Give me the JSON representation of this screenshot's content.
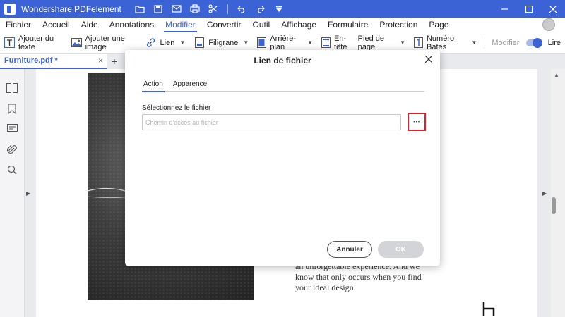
{
  "app": {
    "title": "Wondershare PDFelement",
    "quick_access_icons": [
      "folder-icon",
      "save-icon",
      "mail-icon",
      "print-icon",
      "scissors-icon",
      "undo-icon",
      "redo-icon",
      "dropdown-icon"
    ],
    "accent_color": "#3b63d6"
  },
  "menu": {
    "items": [
      "Fichier",
      "Accueil",
      "Aide",
      "Annotations",
      "Modifier",
      "Convertir",
      "Outil",
      "Affichage",
      "Formulaire",
      "Protection",
      "Page"
    ],
    "active": "Modifier"
  },
  "toolbar": {
    "add_text": "Ajouter du texte",
    "add_image": "Ajouter une image",
    "link": "Lien",
    "watermark": "Filigrane",
    "background": "Arrière-plan",
    "header_label": "En-tête",
    "footer_label": "Pied de page",
    "bates": "Numéro Bates",
    "edit_mode": "Modifier",
    "read_mode": "Lire"
  },
  "tabs": {
    "doc_name": "Furniture.pdf *",
    "close": "×",
    "add": "+"
  },
  "page_text": {
    "lines": [
      "an unforgettable experience. And we",
      "know that only occurs when you find",
      "your ideal design."
    ]
  },
  "dialog": {
    "title": "Lien de fichier",
    "tabs": [
      "Action",
      "Apparence"
    ],
    "active_tab": "Action",
    "field_label": "Sélectionnez le fichier",
    "field_placeholder": "Chemin d'accès au fichier",
    "field_value": "",
    "browse": "···",
    "cancel": "Annuler",
    "ok": "OK",
    "highlight_color": "#e0212b"
  }
}
